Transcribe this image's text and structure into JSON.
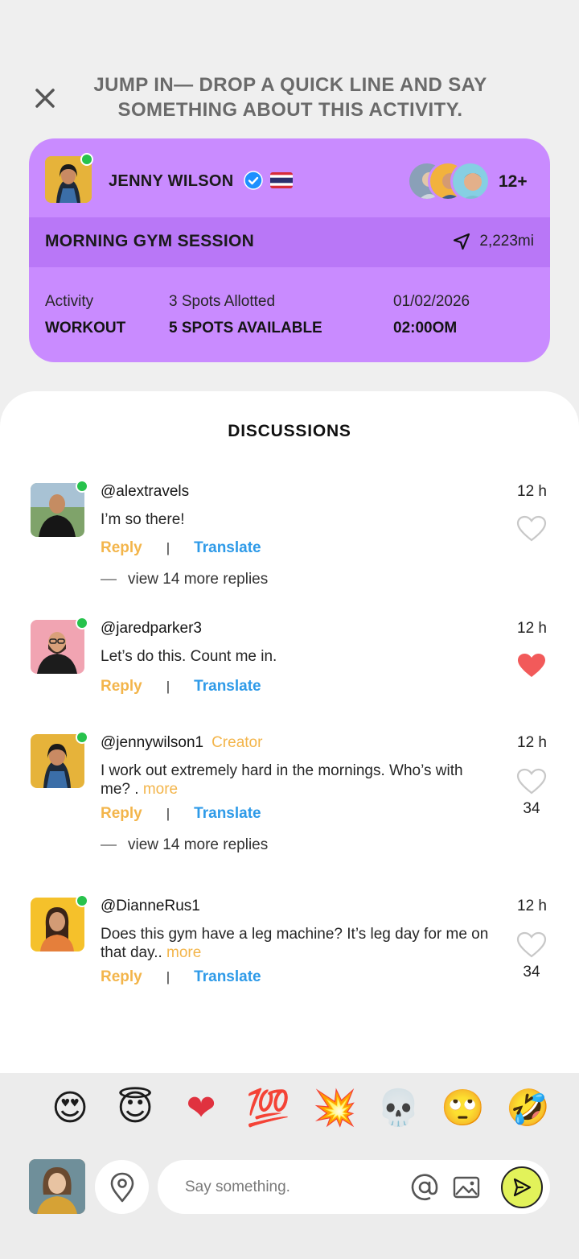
{
  "header": {
    "prompt": "JUMP IN— DROP A QUICK LINE AND SAY SOMETHING ABOUT THIS ACTIVITY."
  },
  "activity": {
    "host_name": "JENNY WILSON",
    "participants_more": "12+",
    "title": "MORNING GYM SESSION",
    "distance": "2,223mi",
    "activity_label": "Activity",
    "activity_value": "WORKOUT",
    "spots_label": "3 Spots Allotted",
    "spots_value": "5 SPOTS AVAILABLE",
    "date": "01/02/2026",
    "time": "02:00OM",
    "colors": {
      "card": "#c98bff",
      "band": "#b977f7"
    }
  },
  "discussions": {
    "title": "DISCUSSIONS",
    "comments": [
      {
        "user": "@alextravels",
        "badge": "",
        "text": "I’m so there!",
        "more": "",
        "time": "12 h",
        "liked": false,
        "likes": "",
        "reply_label": "Reply",
        "translate_label": "Translate",
        "view_replies": "view  14 more replies"
      },
      {
        "user": "@jaredparker3",
        "badge": "",
        "text": "Let’s do this. Count me in.",
        "more": "",
        "time": "12 h",
        "liked": true,
        "likes": "",
        "reply_label": "Reply",
        "translate_label": "Translate",
        "view_replies": ""
      },
      {
        "user": "@jennywilson1",
        "badge": "Creator",
        "text": "I work out extremely hard in the mornings. Who’s with me? . ",
        "more": "more",
        "time": "12 h",
        "liked": false,
        "likes": "34",
        "reply_label": "Reply",
        "translate_label": "Translate",
        "view_replies": "view  14 more replies"
      },
      {
        "user": "@DianneRus1",
        "badge": "",
        "text": "Does this gym have a leg machine?  It’s leg day for me on that day.. ",
        "more": "more",
        "time": "12 h",
        "liked": false,
        "likes": "34",
        "reply_label": "Reply",
        "translate_label": "Translate",
        "view_replies": ""
      }
    ]
  },
  "emoji_bar": {
    "emojis": [
      "😍",
      "😇",
      "❤",
      "💯",
      "💥",
      "💀",
      "🙄",
      "🤣"
    ],
    "names": [
      "heart-eyes",
      "smiling-halo",
      "red-heart",
      "hundred-points",
      "collision",
      "skull",
      "eye-roll",
      "rolling-laughing"
    ]
  },
  "composer": {
    "placeholder": "Say something.",
    "value": ""
  }
}
